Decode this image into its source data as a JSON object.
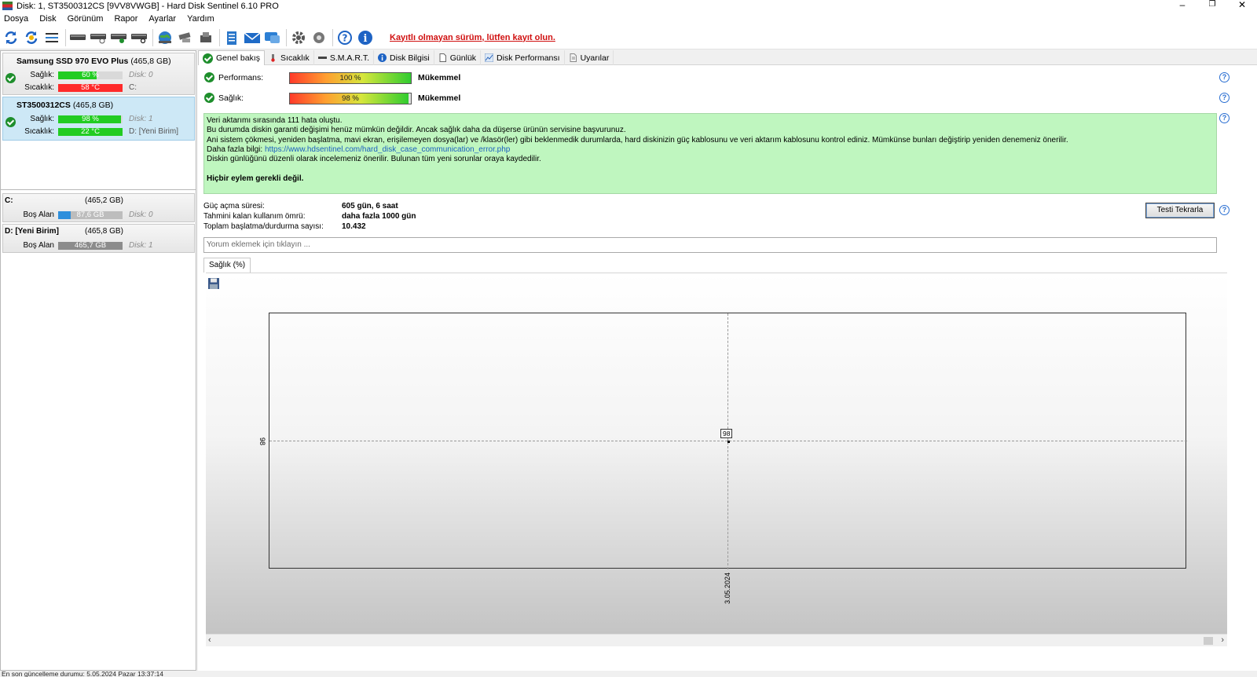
{
  "window": {
    "title": "Disk: 1, ST3500312CS [9VV8VWGB]  -  Hard Disk Sentinel 6.10 PRO",
    "minimize": "–",
    "restore": "❐",
    "close": "✕"
  },
  "menu": [
    "Dosya",
    "Disk",
    "Görünüm",
    "Rapor",
    "Ayarlar",
    "Yardım"
  ],
  "toolbar": {
    "register_link": "Kayıtlı olmayan sürüm, lütfen kayıt olun."
  },
  "disks": [
    {
      "name": "Samsung SSD 970 EVO Plus",
      "capacity": "(465,8 GB)",
      "health_label": "Sağlık:",
      "health": "60 %",
      "health_pct": 60,
      "health_color": "#22cc22",
      "disk_label": "Disk: 0",
      "temp_label": "Sıcaklık:",
      "temp": "58 °C",
      "temp_color": "#ff2a2a",
      "volume": "C:"
    },
    {
      "name": "ST3500312CS",
      "capacity": "(465,8 GB)",
      "health_label": "Sağlık:",
      "health": "98 %",
      "health_pct": 98,
      "health_color": "#22cc22",
      "disk_label": "Disk: 1",
      "temp_label": "Sıcaklık:",
      "temp": "22 °C",
      "temp_color": "#22cc22",
      "volume": "D: [Yeni Birim]"
    }
  ],
  "volumes": [
    {
      "name": "C:",
      "capacity": "(465,2 GB)",
      "free_label": "Boş Alan",
      "free": "87,6 GB",
      "free_pct": 19,
      "disk_label": "Disk: 0",
      "fill_color": "#2e8fdc"
    },
    {
      "name": "D: [Yeni Birim]",
      "capacity": "(465,8 GB)",
      "free_label": "Boş Alan",
      "free": "465,7 GB",
      "free_pct": 100,
      "disk_label": "Disk: 1",
      "fill_color": "#8c8c8c"
    }
  ],
  "tabs": [
    "Genel bakış",
    "Sıcaklık",
    "S.M.A.R.T.",
    "Disk Bilgisi",
    "Günlük",
    "Disk Performansı",
    "Uyarılar"
  ],
  "performance": {
    "label": "Performans:",
    "value": "100 %",
    "pct": 100,
    "status": "Mükemmel"
  },
  "health": {
    "label": "Sağlık:",
    "value": "98 %",
    "pct": 98,
    "status": "Mükemmel"
  },
  "message": {
    "line1": "Veri aktarımı sırasında 111 hata oluştu.",
    "line2": "Bu durumda diskin garanti değişimi henüz mümkün değildir. Ancak sağlık daha da düşerse ürünün servisine başvurunuz.",
    "line3": "Ani sistem çökmesi, yeniden başlatma, mavi ekran, erişilemeyen dosya(lar) ve /klasör(ler) gibi beklenmedik durumlarda, hard diskinizin güç kablosunu ve veri aktarım kablosunu kontrol ediniz. Mümkünse bunları değiştirip yeniden denemeniz önerilir.",
    "line4_prefix": "Daha fazla bilgi:",
    "link": "https://www.hdsentinel.com/hard_disk_case_communication_error.php",
    "line5": "Diskin günlüğünü düzenli olarak incelemeniz önerilir. Bulunan tüm yeni sorunlar oraya kaydedilir.",
    "action": "Hiçbir eylem gerekli değil."
  },
  "info": {
    "power_on_label": "Güç açma süresi:",
    "power_on": "605 gün, 6 saat",
    "lifetime_label": "Tahmini kalan kullanım ömrü:",
    "lifetime": "daha fazla 1000 gün",
    "startstop_label": "Toplam başlatma/durdurma sayısı:",
    "startstop": "10.432"
  },
  "retest_button": "Testi Tekrarla",
  "comment_placeholder": "Yorum eklemek için tıklayın ...",
  "chart_tab": "Sağlık (%)",
  "chart_data": {
    "type": "line",
    "x": [
      "3.05.2024"
    ],
    "series": [
      {
        "values": [
          98
        ]
      }
    ],
    "data_labels": [
      "98"
    ],
    "ytick_labels": [
      "98"
    ],
    "xtick_labels": [
      "3.05.2024"
    ],
    "grid": "dashed"
  },
  "statusbar": "En son güncelleme durumu: 5.05.2024 Pazar 13:37:14"
}
